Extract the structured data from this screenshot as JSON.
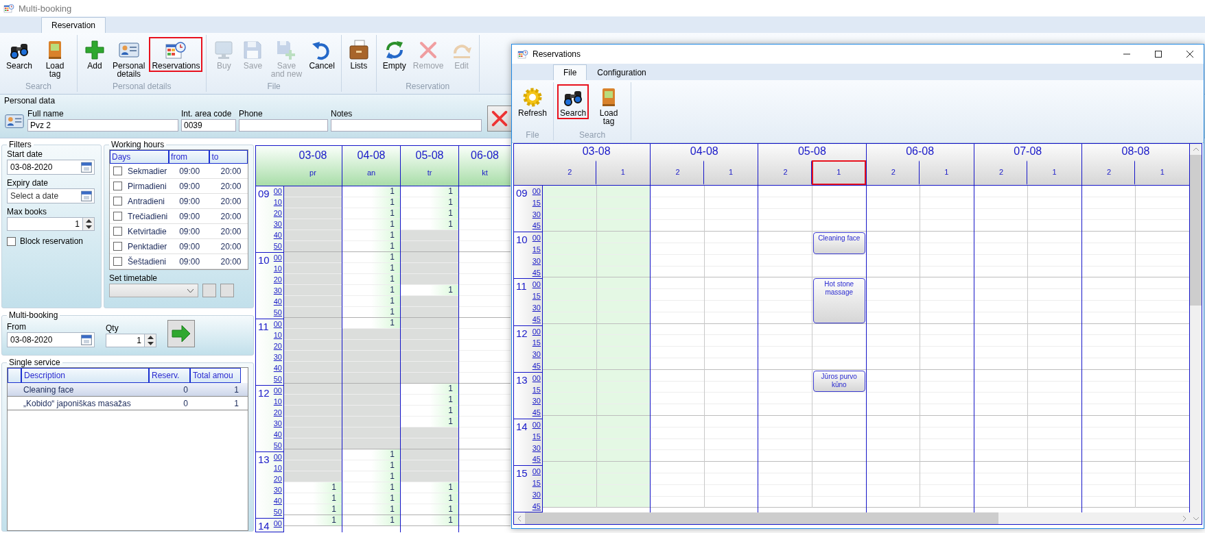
{
  "window": {
    "title": "Multi-booking"
  },
  "ribbon": {
    "tabs": [
      {
        "label": "Reservation",
        "selected": true
      }
    ],
    "groups": [
      {
        "label": "Search",
        "buttons": [
          {
            "label": "Search",
            "disabled": false,
            "highlighted": false
          },
          {
            "label": "Load tag",
            "disabled": false,
            "highlighted": false
          }
        ]
      },
      {
        "label": "Personal details",
        "buttons": [
          {
            "label": "Add",
            "disabled": false,
            "highlighted": false
          },
          {
            "label": "Personal details",
            "disabled": false,
            "highlighted": false
          },
          {
            "label": "Reservations",
            "disabled": false,
            "highlighted": true
          }
        ]
      },
      {
        "label": "File",
        "buttons": [
          {
            "label": "Buy",
            "disabled": true,
            "highlighted": false
          },
          {
            "label": "Save",
            "disabled": true,
            "highlighted": false
          },
          {
            "label": "Save and new",
            "disabled": true,
            "highlighted": false
          },
          {
            "label": "Cancel",
            "disabled": false,
            "highlighted": false
          }
        ]
      },
      {
        "buttons": [
          {
            "label": "Lists",
            "disabled": false,
            "highlighted": false
          }
        ]
      },
      {
        "label": "Reservation",
        "buttons": [
          {
            "label": "Empty",
            "disabled": false,
            "highlighted": false
          },
          {
            "label": "Remove",
            "disabled": true,
            "highlighted": false
          },
          {
            "label": "Edit",
            "disabled": true,
            "highlighted": false
          }
        ]
      }
    ]
  },
  "personal_data": {
    "title": "Personal data",
    "fields": [
      {
        "label": "Full name",
        "value": "Pvz 2"
      },
      {
        "label": "Int. area code",
        "value": "0039"
      },
      {
        "label": "Phone"
      },
      {
        "label": "Notes"
      }
    ]
  },
  "filters": {
    "title": "Filters",
    "start_date": {
      "label": "Start date",
      "value": "03-08-2020"
    },
    "expiry_date": {
      "label": "Expiry date",
      "placeholder": "Select a date"
    },
    "max_books": {
      "label": "Max books",
      "value": "1"
    },
    "block_reservation": {
      "label": "Block reservation",
      "checked": false
    }
  },
  "working_hours": {
    "title": "Working hours",
    "columns": [
      "Days",
      "from",
      "to"
    ],
    "rows": [
      {
        "day": "Sekmadier",
        "from": "09:00",
        "to": "20:00",
        "checked": false
      },
      {
        "day": "Pirmadieni",
        "from": "09:00",
        "to": "20:00",
        "checked": false
      },
      {
        "day": "Antradieni",
        "from": "09:00",
        "to": "20:00",
        "checked": false
      },
      {
        "day": "Trečiadieni",
        "from": "09:00",
        "to": "20:00",
        "checked": false
      },
      {
        "day": "Ketvirtadie",
        "from": "09:00",
        "to": "20:00",
        "checked": false
      },
      {
        "day": "Penktadier",
        "from": "09:00",
        "to": "20:00",
        "checked": false
      },
      {
        "day": "Šeštadieni",
        "from": "09:00",
        "to": "20:00",
        "checked": false
      }
    ],
    "set_timetable": {
      "label": "Set timetable"
    }
  },
  "multi_booking": {
    "title": "Multi-booking",
    "from": {
      "label": "From",
      "value": "03-08-2020"
    },
    "qty": {
      "label": "Qty",
      "value": "1"
    }
  },
  "single_service": {
    "title": "Single service",
    "columns": [
      "Description",
      "Reserv.",
      "Total amou"
    ],
    "rows": [
      {
        "description": "Cleaning face",
        "reserv": "0",
        "total": "1",
        "selected": true
      },
      {
        "description": "„Kobido“ japoniškas masažas",
        "reserv": "0",
        "total": "1",
        "selected": false
      }
    ]
  },
  "schedule": {
    "times": [
      {
        "hour": "09",
        "minutes": [
          "00",
          "10",
          "20",
          "30",
          "40",
          "50"
        ]
      },
      {
        "hour": "10",
        "minutes": [
          "00",
          "10",
          "20",
          "30",
          "40",
          "50"
        ]
      },
      {
        "hour": "11",
        "minutes": [
          "00",
          "10",
          "20",
          "30",
          "40",
          "50"
        ]
      },
      {
        "hour": "12",
        "minutes": [
          "00",
          "10",
          "20",
          "30",
          "40",
          "50"
        ]
      },
      {
        "hour": "13",
        "minutes": [
          "00",
          "10",
          "20",
          "30",
          "40",
          "50"
        ]
      },
      {
        "hour": "14",
        "minutes": [
          "00"
        ]
      }
    ],
    "days": [
      {
        "date": "03-08",
        "weekday": "pr",
        "slots": [
          {
            "kind": "blocked"
          },
          {
            "kind": "blocked"
          },
          {
            "kind": "blocked"
          },
          {
            "kind": "blocked"
          },
          {
            "kind": "blocked"
          },
          {
            "kind": "blocked"
          },
          {
            "kind": "blocked"
          },
          {
            "kind": "blocked"
          },
          {
            "kind": "blocked"
          },
          {
            "kind": "blocked"
          },
          {
            "kind": "blocked"
          },
          {
            "kind": "blocked"
          },
          {
            "kind": "blocked"
          },
          {
            "kind": "blocked"
          },
          {
            "kind": "blocked"
          },
          {
            "kind": "blocked"
          },
          {
            "kind": "blocked"
          },
          {
            "kind": "blocked"
          },
          {
            "kind": "blocked"
          },
          {
            "kind": "blocked"
          },
          {
            "kind": "blocked"
          },
          {
            "kind": "blocked"
          },
          {
            "kind": "blocked"
          },
          {
            "kind": "blocked"
          },
          {
            "kind": "blocked"
          },
          {
            "kind": "blocked"
          },
          {
            "kind": "blocked"
          },
          {
            "kind": "open",
            "count": "1"
          },
          {
            "kind": "open",
            "count": "1"
          },
          {
            "kind": "open",
            "count": "1"
          },
          {
            "kind": "open",
            "count": "1"
          }
        ]
      },
      {
        "date": "04-08",
        "weekday": "an",
        "slots": [
          {
            "kind": "open",
            "count": "1"
          },
          {
            "kind": "open",
            "count": "1"
          },
          {
            "kind": "open",
            "count": "1"
          },
          {
            "kind": "open",
            "count": "1"
          },
          {
            "kind": "open",
            "count": "1"
          },
          {
            "kind": "open",
            "count": "1"
          },
          {
            "kind": "open",
            "count": "1"
          },
          {
            "kind": "open",
            "count": "1"
          },
          {
            "kind": "open",
            "count": "1"
          },
          {
            "kind": "open",
            "count": "1"
          },
          {
            "kind": "open",
            "count": "1"
          },
          {
            "kind": "open",
            "count": "1"
          },
          {
            "kind": "open",
            "count": "1"
          },
          {
            "kind": "blocked"
          },
          {
            "kind": "blocked"
          },
          {
            "kind": "blocked"
          },
          {
            "kind": "blocked"
          },
          {
            "kind": "blocked"
          },
          {
            "kind": "blocked"
          },
          {
            "kind": "blocked"
          },
          {
            "kind": "blocked"
          },
          {
            "kind": "blocked"
          },
          {
            "kind": "blocked"
          },
          {
            "kind": "blocked"
          },
          {
            "kind": "open",
            "count": "1"
          },
          {
            "kind": "open",
            "count": "1"
          },
          {
            "kind": "open",
            "count": "1"
          },
          {
            "kind": "open",
            "count": "1"
          },
          {
            "kind": "open",
            "count": "1"
          },
          {
            "kind": "open",
            "count": "1"
          },
          {
            "kind": "open",
            "count": "1"
          }
        ]
      },
      {
        "date": "05-08",
        "weekday": "tr",
        "slots": [
          {
            "kind": "open",
            "count": "1"
          },
          {
            "kind": "open",
            "count": "1"
          },
          {
            "kind": "open",
            "count": "1"
          },
          {
            "kind": "open",
            "count": "1"
          },
          {
            "kind": "blocked"
          },
          {
            "kind": "blocked"
          },
          {
            "kind": "blocked"
          },
          {
            "kind": "blocked"
          },
          {
            "kind": "blocked"
          },
          {
            "kind": "open",
            "count": "1"
          },
          {
            "kind": "blocked"
          },
          {
            "kind": "blocked"
          },
          {
            "kind": "blocked"
          },
          {
            "kind": "blocked"
          },
          {
            "kind": "blocked"
          },
          {
            "kind": "blocked"
          },
          {
            "kind": "blocked"
          },
          {
            "kind": "blocked"
          },
          {
            "kind": "open",
            "count": "1"
          },
          {
            "kind": "open",
            "count": "1"
          },
          {
            "kind": "open",
            "count": "1"
          },
          {
            "kind": "open",
            "count": "1"
          },
          {
            "kind": "blocked"
          },
          {
            "kind": "blocked"
          },
          {
            "kind": "blocked"
          },
          {
            "kind": "blocked"
          },
          {
            "kind": "blocked"
          },
          {
            "kind": "open",
            "count": "1"
          },
          {
            "kind": "open",
            "count": "1"
          },
          {
            "kind": "open",
            "count": "1"
          },
          {
            "kind": "open",
            "count": "1"
          }
        ]
      },
      {
        "date": "06-08",
        "weekday": "kt",
        "slots": [
          {
            "kind": "empty"
          },
          {
            "kind": "empty"
          },
          {
            "kind": "empty"
          },
          {
            "kind": "empty"
          },
          {
            "kind": "empty"
          },
          {
            "kind": "empty"
          },
          {
            "kind": "empty"
          },
          {
            "kind": "empty"
          },
          {
            "kind": "empty"
          },
          {
            "kind": "empty"
          },
          {
            "kind": "empty"
          },
          {
            "kind": "empty"
          },
          {
            "kind": "empty"
          },
          {
            "kind": "empty"
          },
          {
            "kind": "empty"
          },
          {
            "kind": "empty"
          },
          {
            "kind": "empty"
          },
          {
            "kind": "empty"
          },
          {
            "kind": "empty"
          },
          {
            "kind": "empty"
          },
          {
            "kind": "empty"
          },
          {
            "kind": "empty"
          },
          {
            "kind": "empty"
          },
          {
            "kind": "empty"
          },
          {
            "kind": "empty"
          },
          {
            "kind": "empty"
          },
          {
            "kind": "empty"
          },
          {
            "kind": "empty"
          },
          {
            "kind": "empty"
          },
          {
            "kind": "empty"
          },
          {
            "kind": "empty"
          }
        ]
      }
    ]
  },
  "reservations_window": {
    "title": "Reservations",
    "tabs": [
      {
        "label": "File",
        "selected": true
      },
      {
        "label": "Configuration",
        "selected": false
      }
    ],
    "groups": [
      {
        "label": "File",
        "buttons": [
          {
            "label": "Refresh",
            "highlighted": false
          }
        ]
      },
      {
        "label": "Search",
        "buttons": [
          {
            "label": "Search",
            "highlighted": true
          },
          {
            "label": "Load tag",
            "highlighted": false
          }
        ]
      }
    ],
    "times": [
      {
        "hour": "09",
        "minutes": [
          "00",
          "15",
          "30",
          "45"
        ]
      },
      {
        "hour": "10",
        "minutes": [
          "00",
          "15",
          "30",
          "45"
        ]
      },
      {
        "hour": "11",
        "minutes": [
          "00",
          "15",
          "30",
          "45"
        ]
      },
      {
        "hour": "12",
        "minutes": [
          "00",
          "15",
          "30",
          "45"
        ]
      },
      {
        "hour": "13",
        "minutes": [
          "00",
          "15",
          "30",
          "45"
        ]
      },
      {
        "hour": "14",
        "minutes": [
          "00",
          "15",
          "30",
          "45"
        ]
      },
      {
        "hour": "15",
        "minutes": [
          "00",
          "15",
          "30",
          "45"
        ]
      }
    ],
    "days": [
      {
        "date": "03-08",
        "shaded": true,
        "resources": [
          {
            "name": "2",
            "highlighted": false
          },
          {
            "name": "1",
            "highlighted": false
          }
        ]
      },
      {
        "date": "04-08",
        "shaded": false,
        "resources": [
          {
            "name": "2",
            "highlighted": false
          },
          {
            "name": "1",
            "highlighted": false
          }
        ]
      },
      {
        "date": "05-08",
        "shaded": false,
        "resources": [
          {
            "name": "2",
            "highlighted": false
          },
          {
            "name": "1",
            "highlighted": true,
            "slots": [
              {
                "kind": "free"
              },
              {
                "kind": "free"
              },
              {
                "kind": "free"
              },
              {
                "kind": "free"
              },
              {
                "kind": "appointment",
                "title": "Cleaning face"
              },
              {
                "kind": "continued"
              },
              {
                "kind": "free"
              },
              {
                "kind": "free"
              },
              {
                "kind": "appointment",
                "title": "Hot stone massage"
              },
              {
                "kind": "continued"
              },
              {
                "kind": "continued"
              },
              {
                "kind": "continued"
              },
              {
                "kind": "free"
              },
              {
                "kind": "free"
              },
              {
                "kind": "free"
              },
              {
                "kind": "free"
              },
              {
                "kind": "appointment",
                "title": "Jūros purvo kūno"
              },
              {
                "kind": "continued"
              },
              {
                "kind": "free"
              },
              {
                "kind": "free"
              },
              {
                "kind": "free"
              },
              {
                "kind": "free"
              },
              {
                "kind": "free"
              },
              {
                "kind": "free"
              },
              {
                "kind": "free"
              },
              {
                "kind": "free"
              },
              {
                "kind": "free"
              },
              {
                "kind": "free"
              }
            ]
          }
        ]
      },
      {
        "date": "06-08",
        "shaded": false,
        "resources": [
          {
            "name": "2",
            "highlighted": false
          },
          {
            "name": "1",
            "highlighted": false
          }
        ]
      },
      {
        "date": "07-08",
        "shaded": false,
        "resources": [
          {
            "name": "2",
            "highlighted": false
          },
          {
            "name": "1",
            "highlighted": false
          }
        ]
      },
      {
        "date": "08-08",
        "shaded": false,
        "resources": [
          {
            "name": "2",
            "highlighted": false
          },
          {
            "name": "1",
            "highlighted": false
          }
        ]
      }
    ]
  }
}
